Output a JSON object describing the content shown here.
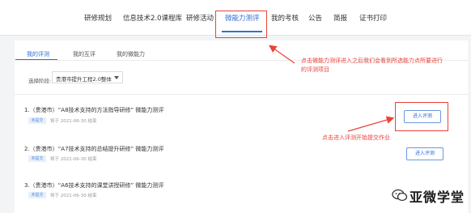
{
  "nav": {
    "items": [
      "研修规划",
      "信息技术2.0课程库",
      "研修活动",
      "微能力测评",
      "我的考核",
      "公告",
      "简报",
      "证书打印"
    ],
    "active": "微能力测评"
  },
  "tabs": {
    "items": [
      "我的评测",
      "我的互评",
      "我的微能力"
    ],
    "active": "我的评测"
  },
  "filter": {
    "label": "选择阶段:",
    "selected": "贵港市提升工程2.0整体"
  },
  "assessments": [
    {
      "title": "1.（贵港市）“A8技术支持的方法指导研修” 微能力测评",
      "tag": "未提交",
      "deadline": "将于 2021-06-30 结束",
      "button": "进入评测"
    },
    {
      "title": "2.（贵港市）“A7技术支持的总结提升研修” 微能力测评",
      "tag": "未提交",
      "deadline": "将于 2021-06-30 结束",
      "button": "进入评测"
    },
    {
      "title": "3.（贵港市）“A6技术支持的课堂讲授研修” 微能力测评",
      "tag": "未提交",
      "deadline": "将于 2021-06-30 结束",
      "button": ""
    }
  ],
  "annotations": {
    "top_line1": "点击微能力测评进入之后我们会看到所选能力点所要进行",
    "top_line2": "的评测项目",
    "bottom": "点击进入评测开始提交作业"
  },
  "watermark": {
    "text": "亚微学堂"
  },
  "colors": {
    "accent": "#2f6fd6",
    "annotation": "#e8433a"
  }
}
